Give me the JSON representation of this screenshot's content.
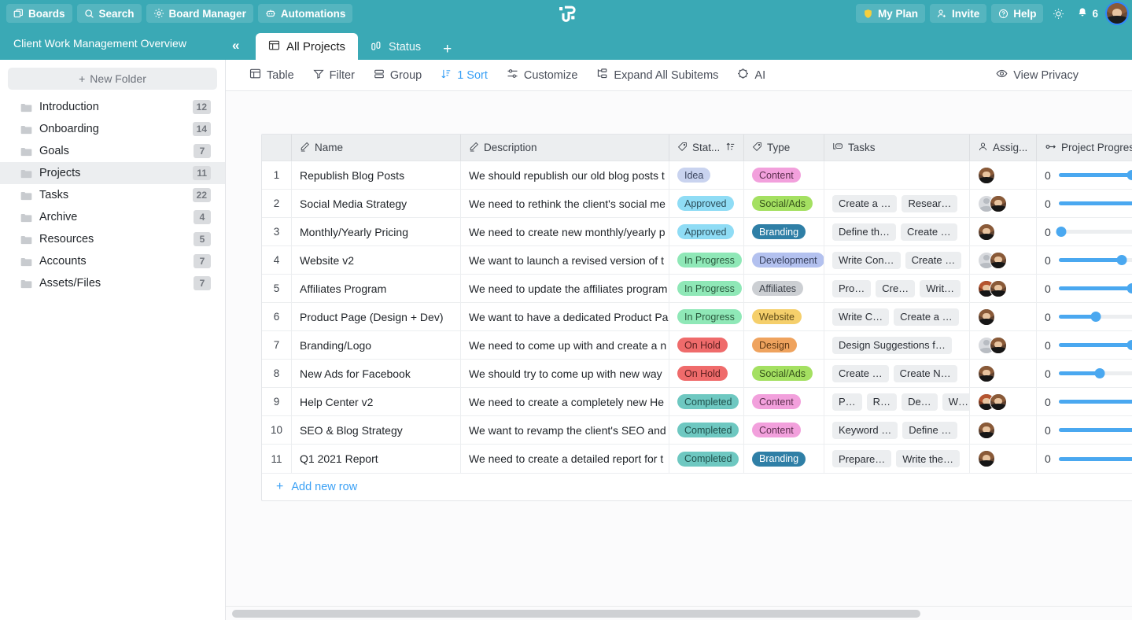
{
  "theme": {
    "accent": "#3aa9b5",
    "link": "#3aa0f5",
    "slider": "#4aa8f0"
  },
  "topbar": {
    "left_buttons": [
      {
        "label": "Boards",
        "icon": "boards-icon"
      },
      {
        "label": "Search",
        "icon": "search-icon"
      },
      {
        "label": "Board Manager",
        "icon": "gear-icon"
      },
      {
        "label": "Automations",
        "icon": "robot-icon"
      }
    ],
    "right_buttons": [
      {
        "label": "My Plan",
        "icon": "shield-icon"
      },
      {
        "label": "Invite",
        "icon": "user-plus-icon"
      },
      {
        "label": "Help",
        "icon": "question-circle-icon"
      }
    ],
    "theme_toggle_icon": "sun-icon",
    "notifications_icon": "bell-icon",
    "notifications_count": "6",
    "avatar": "user-avatar"
  },
  "sidebar": {
    "title": "Client Work Management Overview",
    "collapse_icon": "chevron-double-left-icon",
    "new_folder_label": "New Folder",
    "items": [
      {
        "label": "Introduction",
        "count": "12",
        "selected": false
      },
      {
        "label": "Onboarding",
        "count": "14",
        "selected": false
      },
      {
        "label": "Goals",
        "count": "7",
        "selected": false
      },
      {
        "label": "Projects",
        "count": "11",
        "selected": true
      },
      {
        "label": "Tasks",
        "count": "22",
        "selected": false
      },
      {
        "label": "Archive",
        "count": "4",
        "selected": false
      },
      {
        "label": "Resources",
        "count": "5",
        "selected": false
      },
      {
        "label": "Accounts",
        "count": "7",
        "selected": false
      },
      {
        "label": "Assets/Files",
        "count": "7",
        "selected": false
      }
    ]
  },
  "tabs": {
    "items": [
      {
        "label": "All Projects",
        "icon": "table-icon",
        "active": true
      },
      {
        "label": "Status",
        "icon": "kanban-icon",
        "active": false
      }
    ],
    "add_label": "+"
  },
  "toolbar": {
    "items": [
      {
        "label": "Table",
        "icon": "table-icon",
        "accent": false
      },
      {
        "label": "Filter",
        "icon": "funnel-icon",
        "accent": false
      },
      {
        "label": "Group",
        "icon": "group-icon",
        "accent": false
      },
      {
        "label": "1 Sort",
        "icon": "sort-icon",
        "accent": true
      },
      {
        "label": "Customize",
        "icon": "sliders-icon",
        "accent": false
      },
      {
        "label": "Expand All Subitems",
        "icon": "expand-icon",
        "accent": false
      },
      {
        "label": "AI",
        "icon": "chip-icon",
        "accent": false
      }
    ],
    "privacy_label": "View Privacy",
    "privacy_icon": "eye-icon"
  },
  "table": {
    "columns": [
      {
        "key": "num",
        "label": "",
        "icon": ""
      },
      {
        "key": "name",
        "label": "Name",
        "icon": "pencil-icon"
      },
      {
        "key": "desc",
        "label": "Description",
        "icon": "pencil-icon"
      },
      {
        "key": "status",
        "label": "Stat...",
        "icon": "tag-icon",
        "sort_icon": "sort-asc-icon"
      },
      {
        "key": "type",
        "label": "Type",
        "icon": "tag-icon"
      },
      {
        "key": "tasks",
        "label": "Tasks",
        "icon": "subtasks-icon"
      },
      {
        "key": "assign",
        "label": "Assig...",
        "icon": "person-icon"
      },
      {
        "key": "prog",
        "label": "Project Progress",
        "icon": "progress-icon"
      }
    ],
    "add_row_label": "Add new row",
    "rows": [
      {
        "num": "1",
        "name": "Republish Blog Posts",
        "desc": "We should republish our old blog posts t",
        "status": "Idea",
        "status_bg": "#c9d3ef",
        "status_fg": "#3c4660",
        "type": "Content",
        "type_bg": "#f2a0dc",
        "type_fg": "#5c2f4e",
        "tasks": [],
        "assignees": [
          "brown"
        ],
        "progress_value": "0",
        "progress_pct": 73
      },
      {
        "num": "2",
        "name": "Social Media Strategy",
        "desc": "We need to rethink the client's social me",
        "status": "Approved",
        "status_bg": "#8fdcf5",
        "status_fg": "#2b4c59",
        "type": "Social/Ads",
        "type_bg": "#a4e061",
        "type_fg": "#37541b",
        "tasks": [
          "Create a …",
          "Resear…"
        ],
        "assignees": [
          "ghost",
          "brown"
        ],
        "progress_value": "0",
        "progress_pct": 96
      },
      {
        "num": "3",
        "name": "Monthly/Yearly Pricing",
        "desc": "We need to create new monthly/yearly p",
        "status": "Approved",
        "status_bg": "#8fdcf5",
        "status_fg": "#2b4c59",
        "type": "Branding",
        "type_bg": "#2f7fa6",
        "type_fg": "#ffffff",
        "tasks": [
          "Define th…",
          "Create …"
        ],
        "assignees": [
          "brown"
        ],
        "progress_value": "0",
        "progress_pct": 2
      },
      {
        "num": "4",
        "name": "Website v2",
        "desc": "We want to launch a revised version of t",
        "status": "In Progress",
        "status_bg": "#8fe8b7",
        "status_fg": "#2a5a3e",
        "type": "Development",
        "type_bg": "#b3c1ef",
        "type_fg": "#38415e",
        "tasks": [
          "Write Con…",
          "Create …"
        ],
        "assignees": [
          "ghost",
          "brown"
        ],
        "progress_value": "0",
        "progress_pct": 63
      },
      {
        "num": "5",
        "name": "Affiliates Program",
        "desc": "We need to update the affiliates program",
        "status": "In Progress",
        "status_bg": "#8fe8b7",
        "status_fg": "#2a5a3e",
        "type": "Affiliates",
        "type_bg": "#cccfd3",
        "type_fg": "#3c4149",
        "tasks": [
          "Pro…",
          "Cre…",
          "Writ…"
        ],
        "assignees": [
          "red",
          "brown"
        ],
        "progress_value": "0",
        "progress_pct": 73
      },
      {
        "num": "6",
        "name": "Product Page (Design + Dev)",
        "desc": "We want to have a dedicated Product Pa",
        "status": "In Progress",
        "status_bg": "#8fe8b7",
        "status_fg": "#2a5a3e",
        "type": "Website",
        "type_bg": "#f5cf6b",
        "type_fg": "#5e4a17",
        "tasks": [
          "Write C…",
          "Create a …"
        ],
        "assignees": [
          "brown"
        ],
        "progress_value": "0",
        "progress_pct": 37
      },
      {
        "num": "7",
        "name": "Branding/Logo",
        "desc": "We need to come up with and create a n",
        "status": "On Hold",
        "status_bg": "#ef6b6b",
        "status_fg": "#5c1f1f",
        "type": "Design",
        "type_bg": "#efa35e",
        "type_fg": "#5e3814",
        "tasks": [
          "Design Suggestions f…"
        ],
        "assignees": [
          "ghost",
          "brown"
        ],
        "progress_value": "0",
        "progress_pct": 73
      },
      {
        "num": "8",
        "name": "New Ads for Facebook",
        "desc": "We should try to come up with new way",
        "status": "On Hold",
        "status_bg": "#ef6b6b",
        "status_fg": "#5c1f1f",
        "type": "Social/Ads",
        "type_bg": "#a4e061",
        "type_fg": "#37541b",
        "tasks": [
          "Create …",
          "Create N…"
        ],
        "assignees": [
          "brown"
        ],
        "progress_value": "0",
        "progress_pct": 41
      },
      {
        "num": "9",
        "name": "Help Center v2",
        "desc": "We need to create a completely new He",
        "status": "Completed",
        "status_bg": "#6ec8c1",
        "status_fg": "#1f4f4b",
        "type": "Content",
        "type_bg": "#f2a0dc",
        "type_fg": "#5c2f4e",
        "tasks": [
          "P…",
          "R…",
          "De…",
          "W…"
        ],
        "assignees": [
          "red",
          "brown"
        ],
        "progress_value": "0",
        "progress_pct": 100
      },
      {
        "num": "10",
        "name": "SEO & Blog Strategy",
        "desc": "We want to revamp the client's SEO and",
        "status": "Completed",
        "status_bg": "#6ec8c1",
        "status_fg": "#1f4f4b",
        "type": "Content",
        "type_bg": "#f2a0dc",
        "type_fg": "#5c2f4e",
        "tasks": [
          "Keyword …",
          "Define …"
        ],
        "assignees": [
          "brown"
        ],
        "progress_value": "0",
        "progress_pct": 100
      },
      {
        "num": "11",
        "name": "Q1 2021 Report",
        "desc": "We need to create a detailed report for t",
        "status": "Completed",
        "status_bg": "#6ec8c1",
        "status_fg": "#1f4f4b",
        "type": "Branding",
        "type_bg": "#2f7fa6",
        "type_fg": "#ffffff",
        "tasks": [
          "Prepare…",
          "Write the…"
        ],
        "assignees": [
          "brown"
        ],
        "progress_value": "0",
        "progress_pct": 100
      }
    ]
  }
}
